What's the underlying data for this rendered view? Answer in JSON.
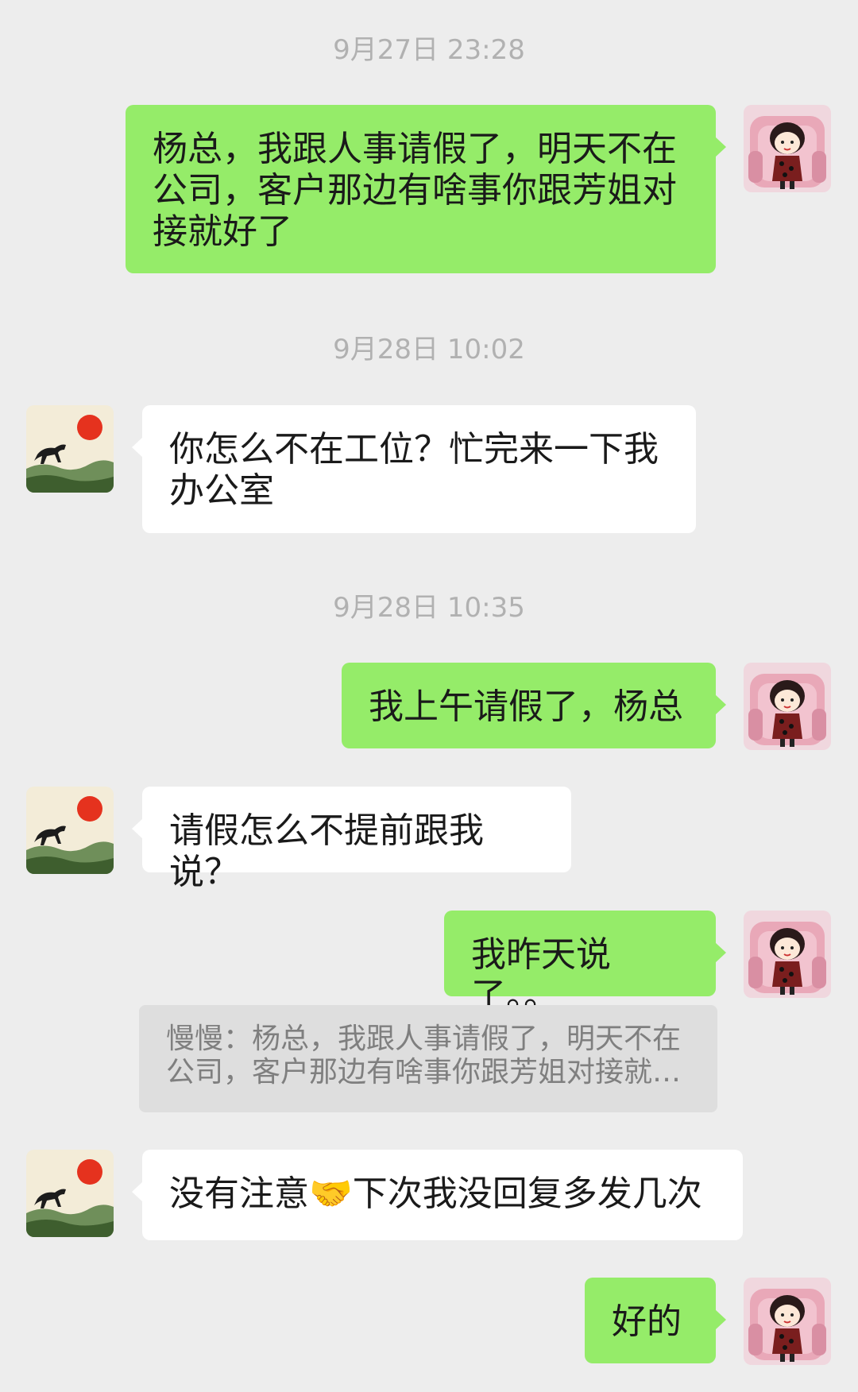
{
  "messages": [
    {
      "type": "time",
      "text": "9月27日 23:28"
    },
    {
      "type": "sent",
      "text": "杨总，我跟人事请假了，明天不在公司，客户那边有啥事你跟芳姐对接就好了"
    },
    {
      "type": "time",
      "text": "9月28日 10:02"
    },
    {
      "type": "recv",
      "text": "你怎么不在工位？忙完来一下我办公室"
    },
    {
      "type": "time",
      "text": "9月28日 10:35"
    },
    {
      "type": "sent",
      "text": "我上午请假了，杨总"
    },
    {
      "type": "recv",
      "text": "请假怎么不提前跟我说？"
    },
    {
      "type": "sent",
      "text": "我昨天说了。。"
    },
    {
      "type": "quote",
      "text": "慢慢：杨总，我跟人事请假了，明天不在公司，客户那边有啥事你跟芳姐对接就…"
    },
    {
      "type": "recv",
      "text_before": "没有注意",
      "emoji": "🤝",
      "text_after": "下次我没回复多发几次"
    },
    {
      "type": "sent",
      "text": "好的"
    }
  ],
  "avatars": {
    "self": "cartoon-girl-avatar",
    "other": "horse-sunset-painting-avatar"
  },
  "colors": {
    "background": "#ededed",
    "sent_bubble": "#95ec69",
    "recv_bubble": "#ffffff",
    "timestamp": "#b1b1b1",
    "quote_bg": "#dedede",
    "quote_text": "#7f7f7f"
  }
}
